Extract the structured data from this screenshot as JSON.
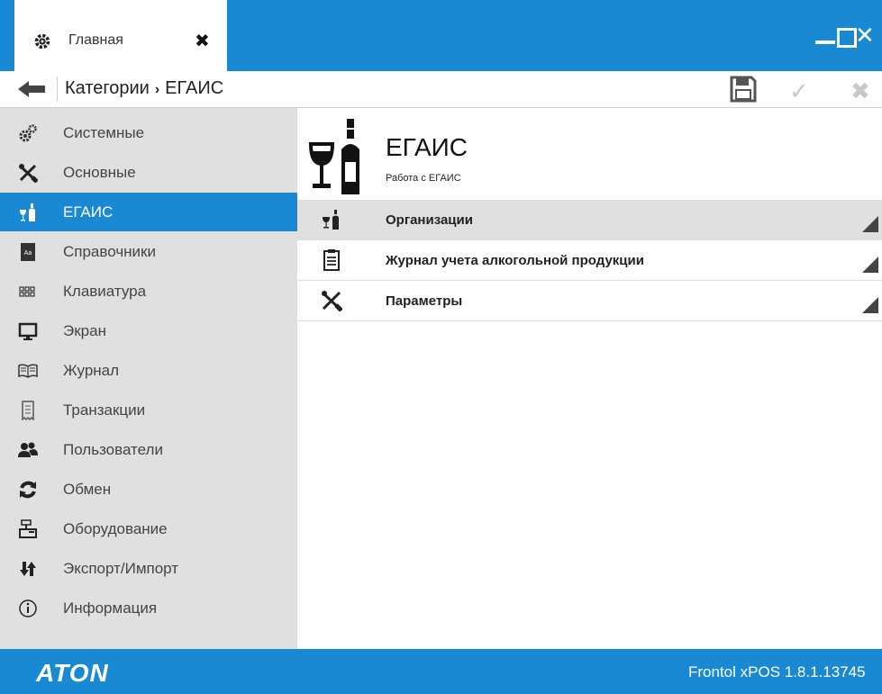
{
  "window": {
    "tab_label": "Главная",
    "tab_close_glyph": "✖",
    "close_glyph": "✕"
  },
  "toolbar": {
    "breadcrumb_root": "Категории",
    "breadcrumb_sep": "›",
    "breadcrumb_current": "ЕГАИС",
    "ok_glyph": "✓",
    "cancel_glyph": "✖"
  },
  "sidebar": {
    "items": [
      {
        "label": "Системные",
        "icon": "gears-icon"
      },
      {
        "label": "Основные",
        "icon": "tools-icon"
      },
      {
        "label": "ЕГАИС",
        "icon": "wine-icon",
        "active": true
      },
      {
        "label": "Справочники",
        "icon": "book-icon"
      },
      {
        "label": "Клавиатура",
        "icon": "keyboard-icon"
      },
      {
        "label": "Экран",
        "icon": "monitor-icon"
      },
      {
        "label": "Журнал",
        "icon": "journal-icon"
      },
      {
        "label": "Транзакции",
        "icon": "receipt-icon"
      },
      {
        "label": "Пользователи",
        "icon": "users-icon"
      },
      {
        "label": "Обмен",
        "icon": "sync-icon"
      },
      {
        "label": "Оборудование",
        "icon": "cash-register-icon"
      },
      {
        "label": "Экспорт/Импорт",
        "icon": "export-import-icon"
      },
      {
        "label": "Информация",
        "icon": "info-icon"
      }
    ]
  },
  "main": {
    "title": "ЕГАИС",
    "subtitle": "Работа с ЕГАИС",
    "rows": [
      {
        "label": "Организации",
        "icon": "wine-icon"
      },
      {
        "label": "Журнал учета алкогольной продукции",
        "icon": "clipboard-icon"
      },
      {
        "label": "Параметры",
        "icon": "tools-icon"
      }
    ]
  },
  "status": {
    "logo": "ATON",
    "version": "Frontol xPOS 1.8.1.13745"
  },
  "colors": {
    "accent": "#1a89d3",
    "sidebar_bg": "#e0e0e0",
    "row_highlight": "#e0e0e0"
  }
}
